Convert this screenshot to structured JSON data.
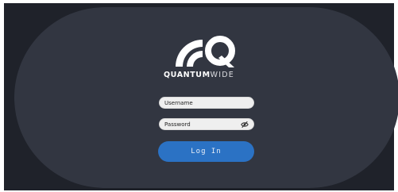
{
  "brand": {
    "logo_icon": "quantumwide-logo-icon",
    "wordmark_bold": "QUANTUM",
    "wordmark_thin": "WIDE"
  },
  "login": {
    "username_placeholder": "Username",
    "password_placeholder": "Password",
    "password_toggle_icon": "eye-slash-icon",
    "submit_label": "Log In"
  },
  "colors": {
    "background": "#323641",
    "frame": "#1f222a",
    "accent": "#2b72c4",
    "field": "#efefef"
  }
}
